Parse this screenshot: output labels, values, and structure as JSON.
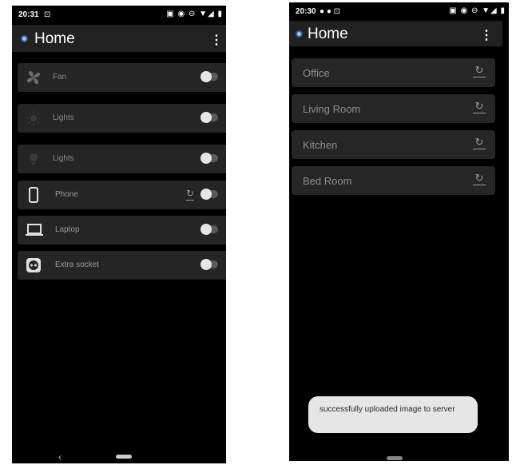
{
  "left_screen": {
    "status": {
      "time": "20:31",
      "left_icons": "⊡",
      "right_icons": "▣ ◉ ⊖ ▼◢ ▮"
    },
    "app_bar": {
      "title": "Home",
      "menu": "⋮"
    },
    "devices": [
      {
        "label": "Fan",
        "icon": "fan-icon",
        "toggle_on": false
      },
      {
        "label": "Lights",
        "icon": "sun-icon",
        "toggle_on": false
      },
      {
        "label": "Lights",
        "icon": "lightbulb-icon",
        "toggle_on": false
      },
      {
        "label": "Phone",
        "icon": "phone-icon",
        "toggle_on": false,
        "sync": "↻"
      },
      {
        "label": "Laptop",
        "icon": "laptop-icon",
        "toggle_on": false
      },
      {
        "label": "Extra socket",
        "icon": "socket-icon",
        "toggle_on": false
      }
    ],
    "nav": {
      "back": "‹"
    }
  },
  "right_screen": {
    "status": {
      "time": "20:30",
      "left_icons": "● ● ⊡",
      "right_icons": "▣ ◉ ⊖ ▼◢ ▮"
    },
    "app_bar": {
      "title": "Home",
      "menu": "⋮"
    },
    "rooms": [
      {
        "label": "Office",
        "sync": "↻"
      },
      {
        "label": "Living Room",
        "sync": "↻"
      },
      {
        "label": "Kitchen",
        "sync": "↻"
      },
      {
        "label": "Bed Room",
        "sync": "↻"
      }
    ],
    "toast": "successfully uploaded image to server"
  },
  "colors": {
    "background": "#000000",
    "app_bar": "#212121",
    "card": "#252525",
    "toast": "#e6e6e6"
  }
}
